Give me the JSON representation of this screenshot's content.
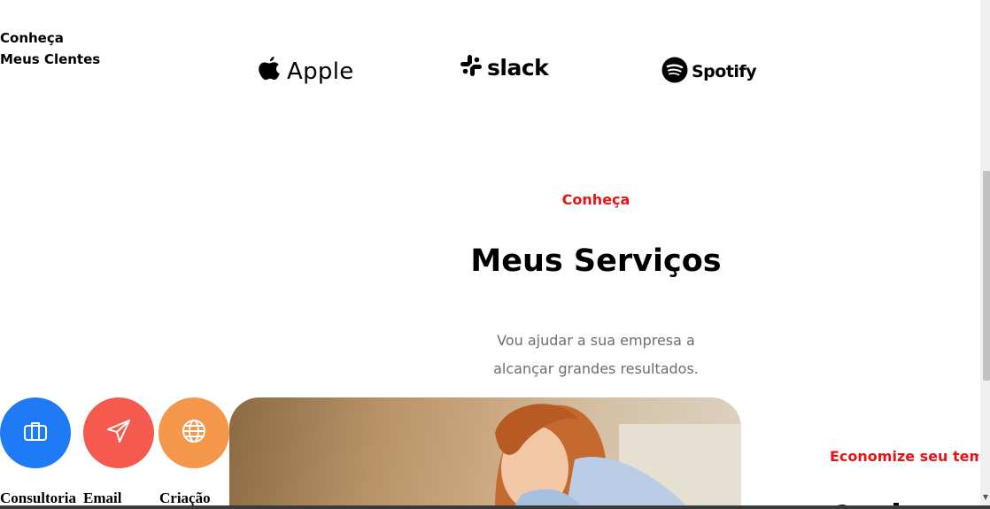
{
  "clients": {
    "heading_line1": "Conheça",
    "heading_line2": "Meus Clentes",
    "logos": [
      {
        "name": "Apple",
        "icon": "apple-logo-icon"
      },
      {
        "name": "slack",
        "icon": "slack-logo-icon"
      },
      {
        "name": "Spotify",
        "icon": "spotify-logo-icon"
      }
    ]
  },
  "services": {
    "kicker": "Conheça",
    "title": "Meus Serviços",
    "description_line1": "Vou ajudar a sua empresa a",
    "description_line2": "alcançar grandes resultados.",
    "items": [
      {
        "label": "Consultoria",
        "icon": "briefcase-icon",
        "color": "#1f7af6"
      },
      {
        "label": "Email",
        "icon": "send-icon",
        "color": "#f55a4e"
      },
      {
        "label": "Criação",
        "icon": "globe-icon",
        "color": "#f5974b"
      }
    ]
  },
  "next_section": {
    "kicker": "Economize seu temp"
  },
  "colors": {
    "accent_red": "#e81414",
    "text_muted": "#6d6d6d"
  }
}
